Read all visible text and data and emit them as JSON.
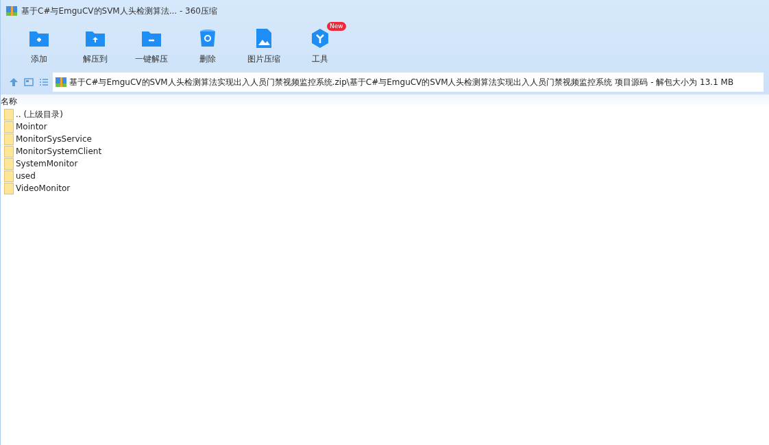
{
  "window": {
    "title": "基于C#与EmguCV的SVM人头检测算法... - 360压缩"
  },
  "toolbar": [
    {
      "kind": "add",
      "label": "添加"
    },
    {
      "kind": "extract",
      "label": "解压到"
    },
    {
      "kind": "oneclick",
      "label": "一键解压"
    },
    {
      "kind": "delete",
      "label": "删除"
    },
    {
      "kind": "image",
      "label": "图片压缩"
    },
    {
      "kind": "tools",
      "label": "工具",
      "badge": "New"
    }
  ],
  "address": {
    "path": "基于C#与EmguCV的SVM人头检测算法实现出入人员门禁视频监控系统.zip\\基于C#与EmguCV的SVM人头检测算法实现出入人员门禁视频监控系统 项目源码 - 解包大小为 13.1 MB"
  },
  "file_list": {
    "columns": [
      "名称"
    ],
    "rows": [
      {
        "name": ".. (上级目录)"
      },
      {
        "name": "Mointor"
      },
      {
        "name": "MonitorSysService"
      },
      {
        "name": "MonitorSystemClient"
      },
      {
        "name": "SystemMonitor"
      },
      {
        "name": "used"
      },
      {
        "name": "VideoMonitor"
      }
    ]
  }
}
